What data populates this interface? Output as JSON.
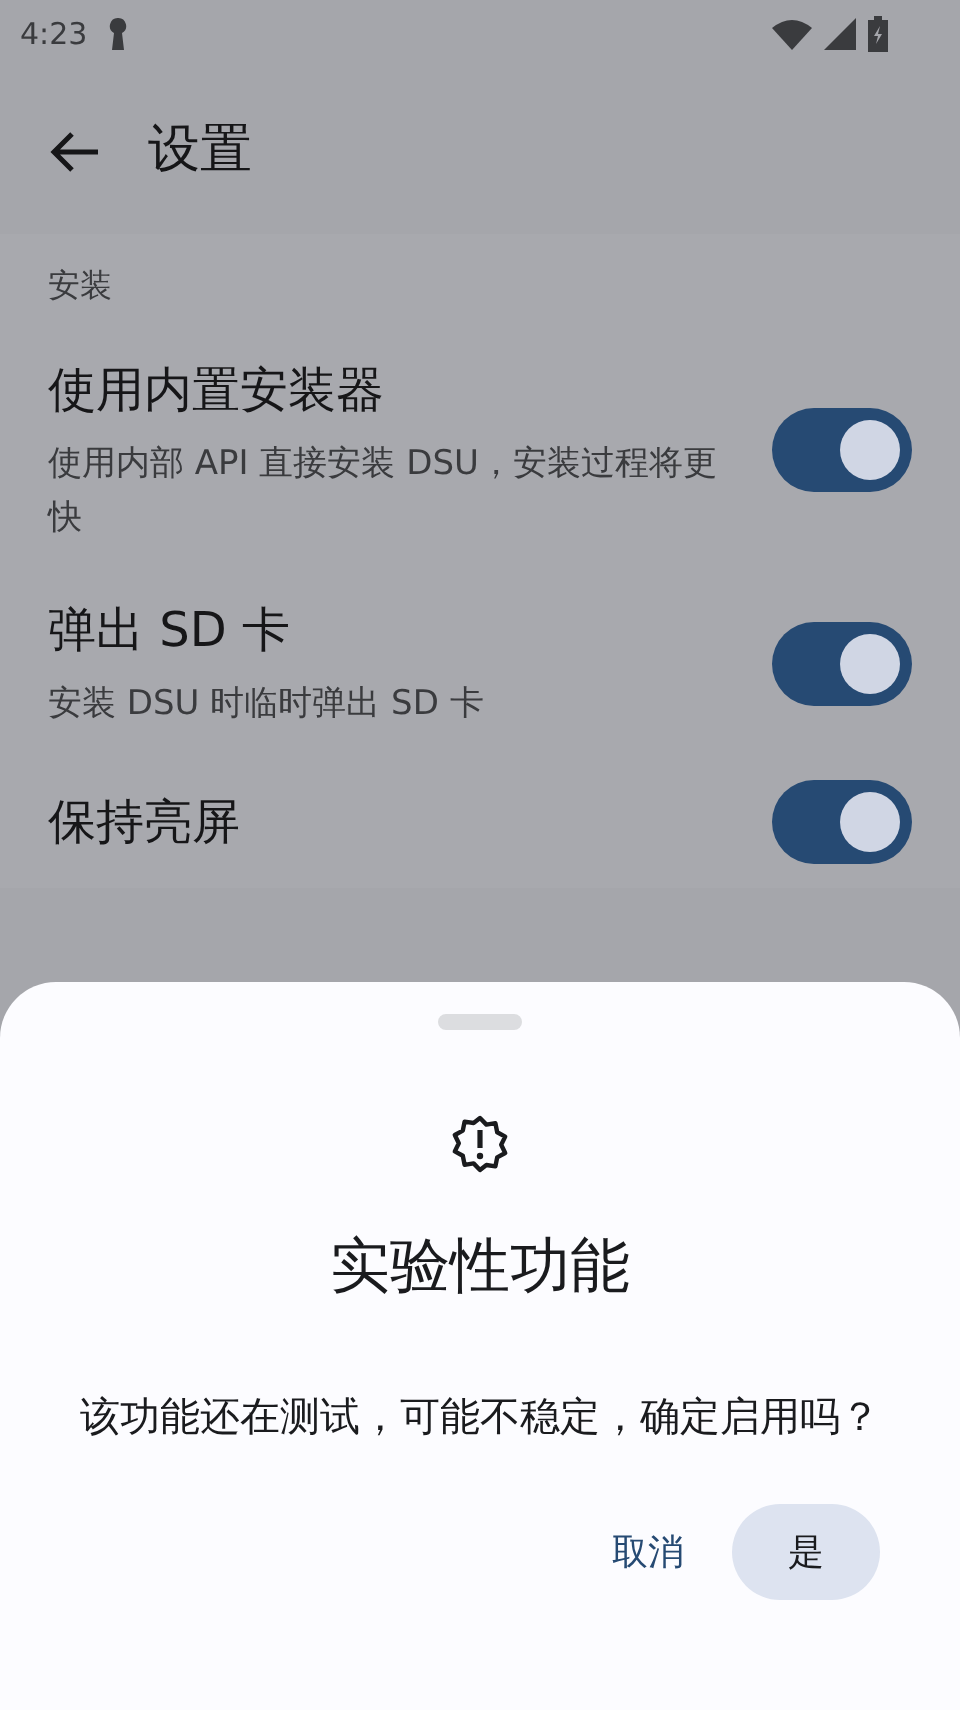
{
  "status_bar": {
    "time": "4:23"
  },
  "app_bar": {
    "title": "设置"
  },
  "section": {
    "title": "安装"
  },
  "settings": [
    {
      "title": "使用内置安装器",
      "subtitle": "使用内部 API 直接安装 DSU，安装过程将更快",
      "on": true
    },
    {
      "title": "弹出 SD 卡",
      "subtitle": "安装 DSU 时临时弹出 SD 卡",
      "on": true
    },
    {
      "title": "保持亮屏",
      "on": true
    }
  ],
  "dialog": {
    "title": "实验性功能",
    "message": "该功能还在测试，可能不稳定，确定启用吗？",
    "buttons": [
      {
        "label": "取消",
        "kind": "text"
      },
      {
        "label": "是",
        "kind": "filled"
      }
    ]
  }
}
